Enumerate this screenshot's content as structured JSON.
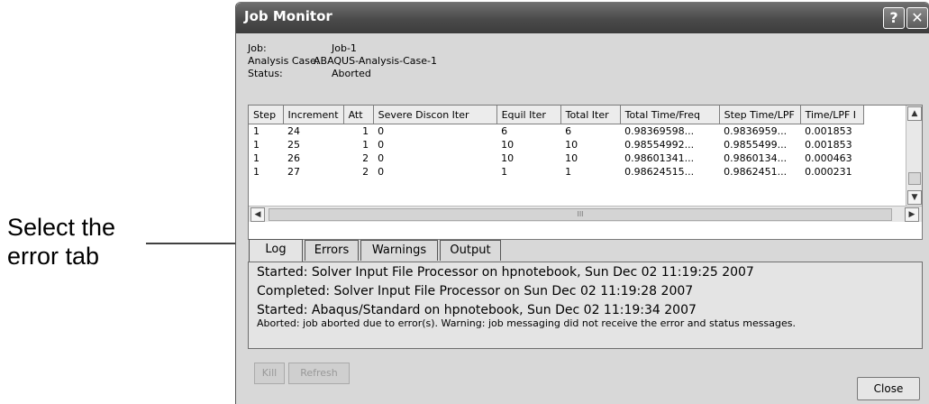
{
  "annotation": {
    "line1": "Select the",
    "line2": "error tab"
  },
  "window": {
    "title": "Job Monitor",
    "help_glyph": "?",
    "close_glyph": "✕"
  },
  "info": [
    {
      "key": "Job:",
      "value": "Job-1"
    },
    {
      "key": "Analysis Case:",
      "value": "ABAQUS-Analysis-Case-1"
    },
    {
      "key": "Status:",
      "value": "Aborted"
    }
  ],
  "table": {
    "columns": [
      "Step",
      "Increment",
      "Att",
      "Severe Discon Iter",
      "Equil Iter",
      "Total Iter",
      "Total Time/Freq",
      "Step Time/LPF",
      "Time/LPF I"
    ],
    "rows": [
      [
        "1",
        "24",
        "1",
        "0",
        "6",
        "6",
        "0.98369598...",
        "0.9836959...",
        "0.001853"
      ],
      [
        "1",
        "25",
        "1",
        "0",
        "10",
        "10",
        "0.98554992...",
        "0.9855499...",
        "0.001853"
      ],
      [
        "1",
        "26",
        "2",
        "0",
        "10",
        "10",
        "0.98601341...",
        "0.9860134...",
        "0.000463"
      ],
      [
        "1",
        "27",
        "2",
        "0",
        "1",
        "1",
        "0.98624515...",
        "0.9862451...",
        "0.000231"
      ]
    ],
    "scroll_grip": "III"
  },
  "tabs": [
    {
      "label": "Log",
      "active": true
    },
    {
      "label": "Errors",
      "active": false
    },
    {
      "label": "Warnings",
      "active": false
    },
    {
      "label": "Output",
      "active": false
    }
  ],
  "log_lines": [
    "Started: Solver Input File Processor on hpnotebook, Sun Dec 02 11:19:25 2007",
    "Completed: Solver Input File Processor on Sun Dec 02 11:19:28 2007",
    "Started: Abaqus/Standard on hpnotebook, Sun Dec 02 11:19:34 2007",
    "Aborted: job aborted due to error(s).  Warning: job messaging did not receive the error and status messages."
  ],
  "buttons": {
    "kill": "Kill",
    "refresh": "Refresh",
    "close": "Close"
  },
  "icons": {
    "up": "▲",
    "down": "▼",
    "left": "◀",
    "right": "▶"
  }
}
